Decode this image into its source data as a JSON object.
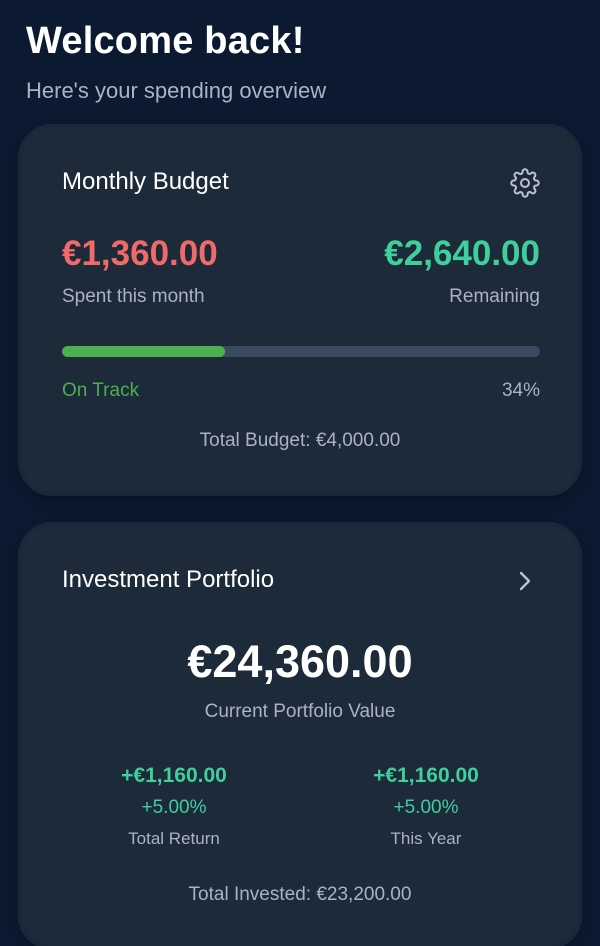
{
  "header": {
    "title": "Welcome back!",
    "subtitle": "Here's your spending overview"
  },
  "budget": {
    "title": "Monthly Budget",
    "spent_amount": "€1,360.00",
    "spent_label": "Spent this month",
    "remaining_amount": "€2,640.00",
    "remaining_label": "Remaining",
    "progress_fraction": 0.34,
    "status": "On Track",
    "percent_label": "34%",
    "total": "Total Budget: €4,000.00",
    "colors": {
      "spent": "#f06a6a",
      "remaining": "#3ecf9c",
      "progress": "#4caf50",
      "track": "#3a4a60"
    },
    "icon": "gear-icon"
  },
  "portfolio": {
    "title": "Investment Portfolio",
    "value": "€24,360.00",
    "value_label": "Current Portfolio Value",
    "icon": "chevron-right-icon",
    "stats": [
      {
        "amount": "+€1,160.00",
        "percent": "+5.00%",
        "label": "Total Return"
      },
      {
        "amount": "+€1,160.00",
        "percent": "+5.00%",
        "label": "This Year"
      }
    ],
    "total_invested": "Total Invested: €23,200.00",
    "colors": {
      "positive": "#3ecf9c"
    }
  },
  "theme": {
    "background": "#0b1a30",
    "card": "#1d2a3a",
    "muted_text": "#a9b3c4"
  }
}
